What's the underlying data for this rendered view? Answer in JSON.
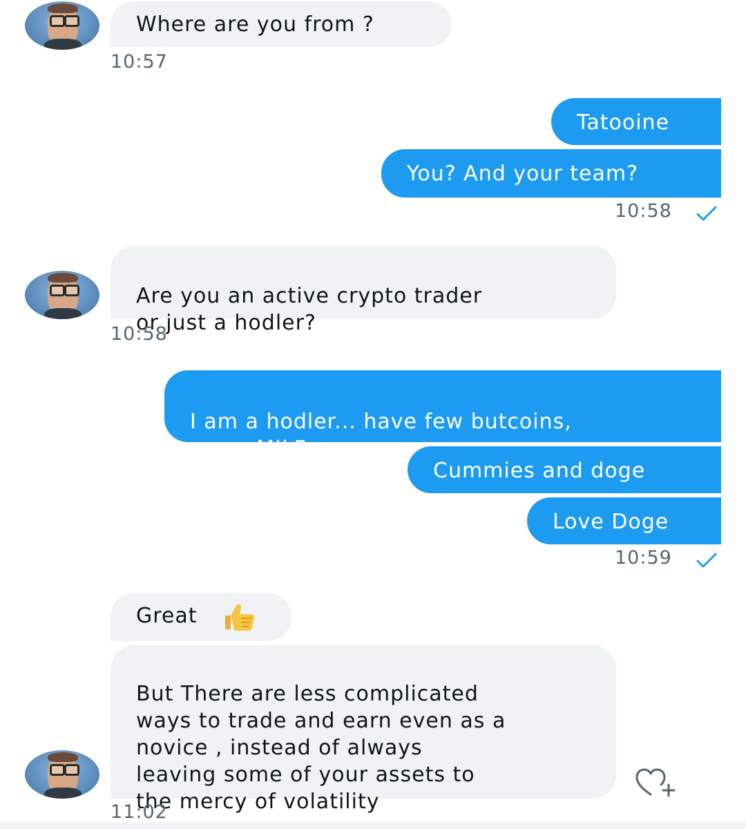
{
  "messages": {
    "m1": {
      "text": "Where are you from ?",
      "time": "10:57"
    },
    "m2": {
      "text": "Tatooine"
    },
    "m3": {
      "text": "You? And your team?",
      "time": "10:58"
    },
    "m4": {
      "text": "Are you an active crypto trader\nor just a hodler?",
      "time": "10:58"
    },
    "m5": {
      "text": "I am a hodler... have few butcoins,\nsome MILF"
    },
    "m6": {
      "text": "Cummies and doge"
    },
    "m7": {
      "text": "Love Doge",
      "time": "10:59"
    },
    "m8": {
      "text": "Great"
    },
    "m9": {
      "text": "But There are less complicated\nways to trade and earn even as a\nnovice , instead of always\nleaving some of your assets to\nthe mercy of volatility",
      "time": "11:02"
    }
  },
  "colors": {
    "outgoing_bubble": "#1d9bf0",
    "incoming_bubble": "#eff3f4",
    "timestamp": "#536471",
    "read_check": "#1d9bf0"
  },
  "icons": {
    "read_receipt": "check-icon",
    "reaction": "heart-add-icon",
    "emoji": "thumbs-up-emoji"
  }
}
